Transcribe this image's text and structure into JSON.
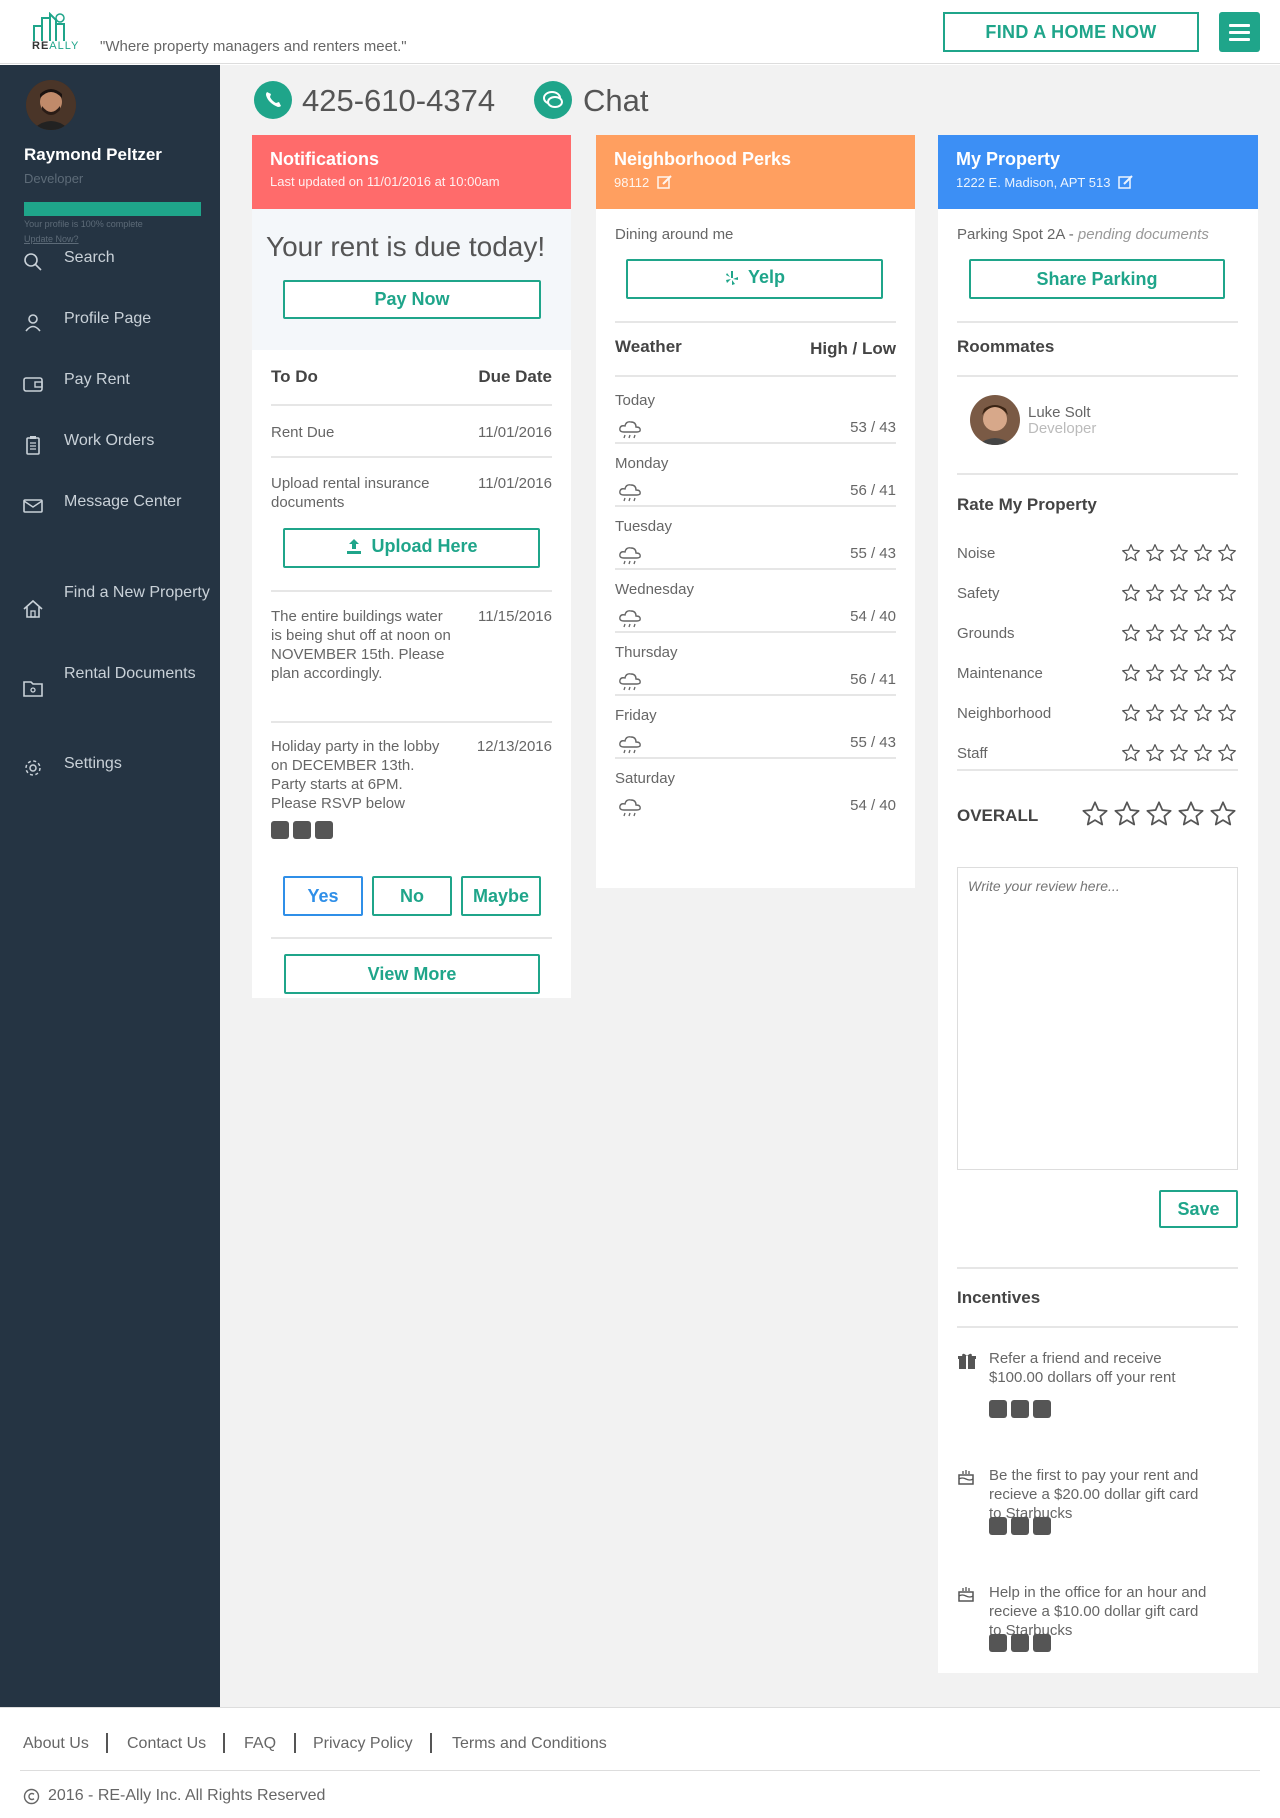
{
  "header": {
    "logo_text_re": "RE",
    "logo_text_ally": "ALLY",
    "tagline": "\"Where property managers and renters meet.\"",
    "find_home_label": "FIND A HOME NOW",
    "menu_icon": "hamburger-icon"
  },
  "sidebar": {
    "user_name": "Raymond Peltzer",
    "user_role": "Developer",
    "profile_complete_pct": 100,
    "profile_note": "Your profile is 100% complete",
    "update_link": "Update Now?",
    "items": [
      {
        "label": "Search",
        "icon": "search-icon"
      },
      {
        "label": "Profile Page",
        "icon": "user-icon"
      },
      {
        "label": "Pay Rent",
        "icon": "wallet-icon"
      },
      {
        "label": "Work Orders",
        "icon": "clipboard-icon"
      },
      {
        "label": "Message Center",
        "icon": "envelope-icon"
      },
      {
        "label": "Find a New Property",
        "icon": "home-icon"
      },
      {
        "label": "Rental Documents",
        "icon": "folder-icon"
      },
      {
        "label": "Settings",
        "icon": "gear-icon"
      }
    ]
  },
  "contact": {
    "phone": "425-610-4374",
    "chat": "Chat"
  },
  "notifications": {
    "title": "Notifications",
    "subtitle": "Last updated on 11/01/2016 at 10:00am",
    "rent_due": "Your rent is due today!",
    "pay_now": "Pay Now",
    "todo_header": "To Do",
    "due_header": "Due Date",
    "items": [
      {
        "text": "Rent Due",
        "date": "11/01/2016"
      },
      {
        "text": "Upload rental insurance documents",
        "date": "11/01/2016"
      },
      {
        "text": "The entire buildings water is being shut off at noon on NOVEMBER 15th. Please plan accordingly.",
        "date": "11/15/2016"
      },
      {
        "text": "Holiday party in the lobby on DECEMBER 13th. Party starts at 6PM. Please RSVP below",
        "date": "12/13/2016"
      }
    ],
    "upload_label": "Upload Here",
    "rsvp": {
      "yes": "Yes",
      "no": "No",
      "maybe": "Maybe"
    },
    "view_more": "View More",
    "color": "#ff6b6b"
  },
  "perks": {
    "title": "Neighborhood Perks",
    "zip": "98112",
    "dining_label": "Dining around me",
    "yelp_label": "Yelp",
    "weather_header": "Weather",
    "highlow_header": "High / Low",
    "days": [
      {
        "day": "Today",
        "temps": "53 / 43"
      },
      {
        "day": "Monday",
        "temps": "56 / 41"
      },
      {
        "day": "Tuesday",
        "temps": "55 / 43"
      },
      {
        "day": "Wednesday",
        "temps": "54 / 40"
      },
      {
        "day": "Thursday",
        "temps": "56 / 41"
      },
      {
        "day": "Friday",
        "temps": "55 / 43"
      },
      {
        "day": "Saturday",
        "temps": "54 / 40"
      }
    ],
    "color": "#ff9f60"
  },
  "property": {
    "title": "My Property",
    "address": "1222 E. Madison, APT 513",
    "parking": "Parking Spot 2A - ",
    "parking_status": "pending documents",
    "share_label": "Share Parking",
    "roommates_header": "Roommates",
    "roommate": {
      "name": "Luke Solt",
      "role": "Developer"
    },
    "rate_header": "Rate My Property",
    "ratings": [
      {
        "label": "Noise",
        "stars": 0
      },
      {
        "label": "Safety",
        "stars": 0
      },
      {
        "label": "Grounds",
        "stars": 0
      },
      {
        "label": "Maintenance",
        "stars": 0
      },
      {
        "label": "Neighborhood",
        "stars": 0
      },
      {
        "label": "Staff",
        "stars": 0
      }
    ],
    "overall_label": "OVERALL",
    "overall_stars": 0,
    "review_placeholder": "Write your review here...",
    "save_label": "Save",
    "incentives_header": "Incentives",
    "incentives": [
      {
        "text": "Refer a friend and receive $100.00 dollars off your rent",
        "icon": "gift-icon"
      },
      {
        "text": "Be the first to pay your rent and recieve a $20.00 dollar gift card to Starbucks",
        "icon": "cake-icon"
      },
      {
        "text": "Help in the office for an hour and recieve a $10.00 dollar gift card to Starbucks",
        "icon": "cake-icon"
      }
    ],
    "color": "#3c8ff5"
  },
  "footer": {
    "links": [
      "About Us",
      "Contact Us",
      "FAQ",
      "Privacy Policy",
      "Terms and Conditions"
    ],
    "copyright": "2016 - RE-Ally Inc. All Rights Reserved",
    "copyright_icon": "copyright-icon"
  },
  "colors": {
    "accent": "#1fa58a",
    "sidebar": "#253443"
  }
}
